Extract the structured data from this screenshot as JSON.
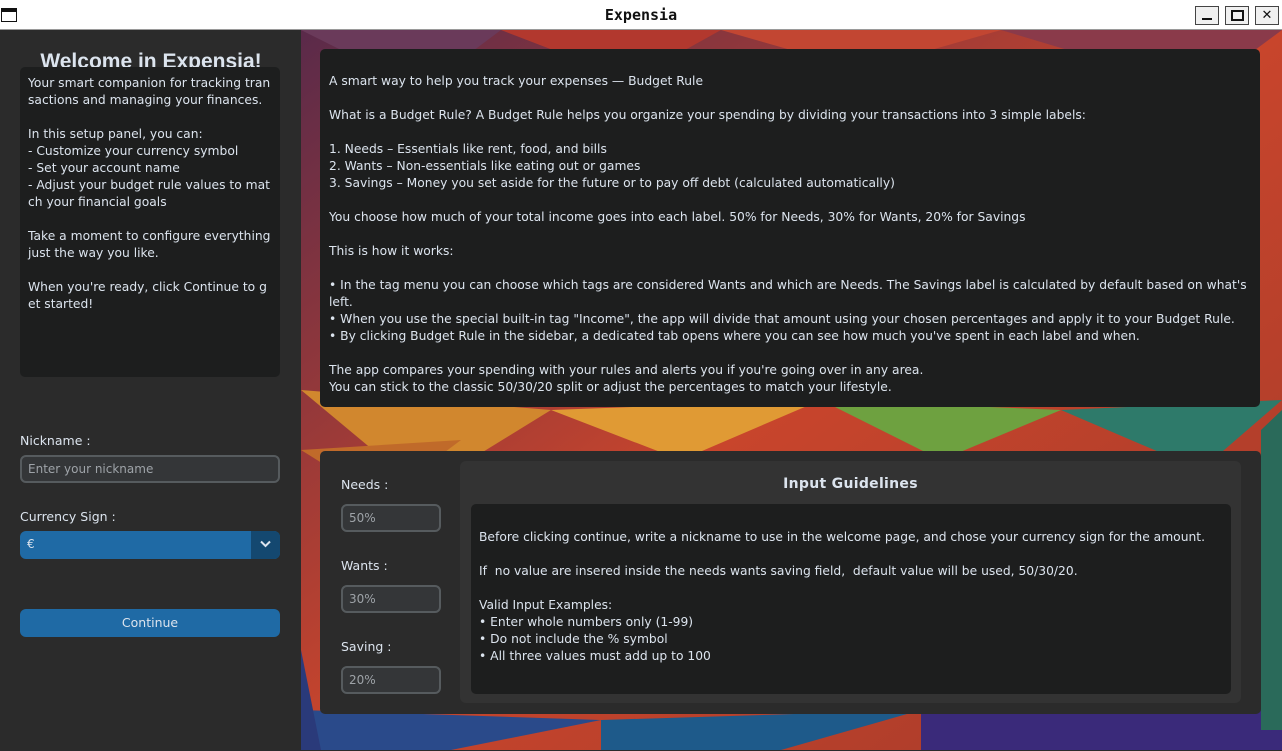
{
  "window": {
    "title": "Expensia",
    "buttons": {
      "minimize": "",
      "maximize": "",
      "close": "✕"
    }
  },
  "sidebar": {
    "welcome_title": "Welcome in Expensia!",
    "intro_text": "Your smart companion for tracking transactions and managing your finances.\n\nIn this setup panel, you can:\n- Customize your currency symbol\n- Set your account name\n- Adjust your budget rule values to match your financial goals\n\nTake a moment to configure everything just the way you like.\n\nWhen you're ready, click Continue to get started!",
    "nickname_label": "Nickname :",
    "nickname_placeholder": "Enter your nickname",
    "currency_label": "Currency Sign :",
    "currency_value": "€",
    "continue_label": "Continue"
  },
  "info": {
    "text": "A smart way to help you track your expenses — Budget Rule\n\nWhat is a Budget Rule? A Budget Rule helps you organize your spending by dividing your transactions into 3 simple labels:\n\n1. Needs – Essentials like rent, food, and bills\n2. Wants – Non-essentials like eating out or games\n3. Savings – Money you set aside for the future or to pay off debt (calculated automatically)\n\nYou choose how much of your total income goes into each label. 50% for Needs, 30% for Wants, 20% for Savings\n\nThis is how it works:\n\n• In the tag menu you can choose which tags are considered Wants and which are Needs. The Savings label is calculated by default based on what's left.\n• When you use the special built-in tag \"Income\", the app will divide that amount using your chosen percentages and apply it to your Budget Rule.\n• By clicking Budget Rule in the sidebar, a dedicated tab opens where you can see how much you've spent in each label and when.\n\nThe app compares your spending with your rules and alerts you if you're going over in any area.\nYou can stick to the classic 50/30/20 split or adjust the percentages to match your lifestyle."
  },
  "budget": {
    "needs_label": "Needs :",
    "needs_placeholder": "50%",
    "wants_label": "Wants :",
    "wants_placeholder": "30%",
    "saving_label": "Saving :",
    "saving_placeholder": "20%"
  },
  "guidelines": {
    "title": "Input Guidelines",
    "text": "Before clicking continue, write a nickname to use in the welcome page, and chose your currency sign for the amount.\n\nIf  no value are insered inside the needs wants saving field,  default value will be used, 50/30/20.\n\nValid Input Examples:\n• Enter whole numbers only (1-99)\n• Do not include the % symbol\n• All three values must add up to 100"
  }
}
